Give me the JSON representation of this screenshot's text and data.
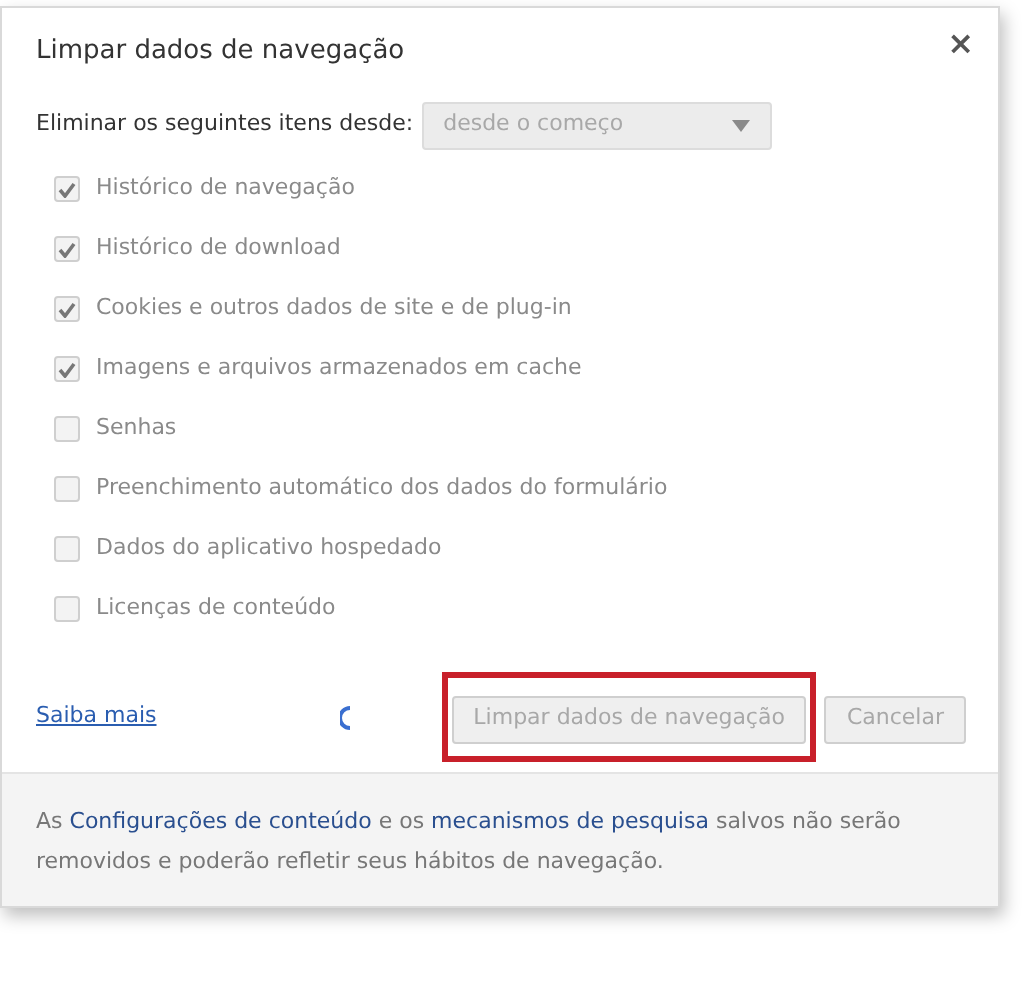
{
  "dialog": {
    "title": "Limpar dados de navegação",
    "close": "×"
  },
  "period": {
    "label": "Eliminar os seguintes itens desde:",
    "value": "desde o começo"
  },
  "items": [
    {
      "label": "Histórico de navegação",
      "checked": true
    },
    {
      "label": "Histórico de download",
      "checked": true
    },
    {
      "label": "Cookies e outros dados de site e de plug-in",
      "checked": true
    },
    {
      "label": "Imagens e arquivos armazenados em cache",
      "checked": true
    },
    {
      "label": "Senhas",
      "checked": false
    },
    {
      "label": "Preenchimento automático dos dados do formulário",
      "checked": false
    },
    {
      "label": "Dados do aplicativo hospedado",
      "checked": false
    },
    {
      "label": "Licenças de conteúdo",
      "checked": false
    }
  ],
  "learn_more": "Saiba mais",
  "busy": true,
  "buttons": [
    {
      "label": "Limpar dados de navegação",
      "disabled": true,
      "highlighted": true
    },
    {
      "label": "Cancelar",
      "disabled": true,
      "highlighted": false
    }
  ],
  "footer": [
    {
      "kind": "text",
      "text": "As "
    },
    {
      "kind": "link",
      "text": "Configurações de conteúdo"
    },
    {
      "kind": "text",
      "text": " e os "
    },
    {
      "kind": "link",
      "text": "mecanismos de pesquisa"
    },
    {
      "kind": "text",
      "text": " salvos não serão removidos e poderão refletir seus hábitos de navegação."
    }
  ]
}
